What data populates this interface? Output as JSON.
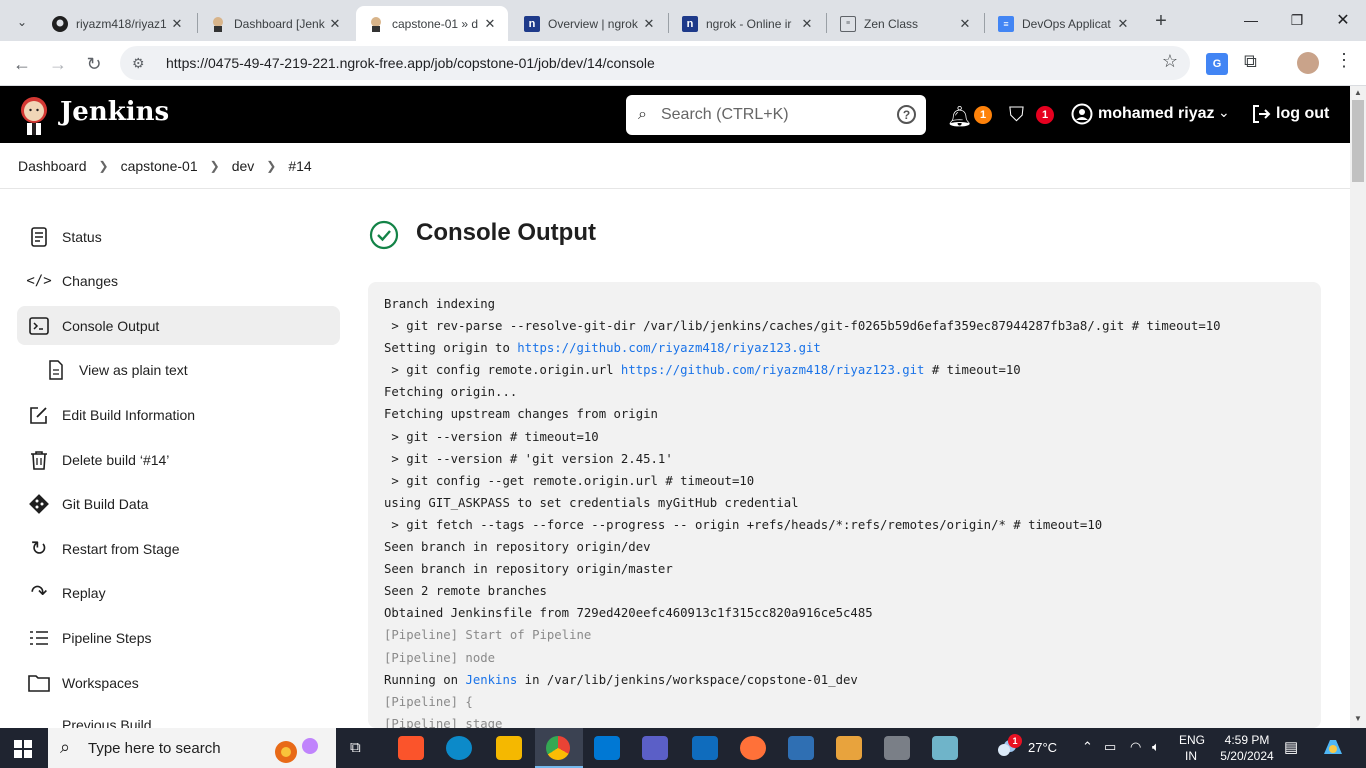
{
  "browser": {
    "tabs": [
      {
        "title": "riyazm418/riyaz1",
        "favicon": "github-icon"
      },
      {
        "title": "Dashboard [Jenk",
        "favicon": "jenkins-icon"
      },
      {
        "title": "capstone-01 » d",
        "favicon": "jenkins-icon"
      },
      {
        "title": "Overview | ngrok",
        "favicon": "ngrok-icon"
      },
      {
        "title": "ngrok - Online ir",
        "favicon": "ngrok-icon"
      },
      {
        "title": "Zen Class",
        "favicon": "zen-icon"
      },
      {
        "title": "DevOps Applicat",
        "favicon": "docs-icon"
      }
    ],
    "active_tab": 2,
    "url": "https://0475-49-47-219-221.ngrok-free.app/job/copstone-01/job/dev/14/console"
  },
  "jenkins": {
    "title": "Jenkins",
    "search_placeholder": "Search (CTRL+K)",
    "notifications_count": "1",
    "security_count": "1",
    "user": "mohamed riyaz",
    "logout": "log out",
    "breadcrumb": [
      "Dashboard",
      "capstone-01",
      "dev",
      "#14"
    ],
    "sidebar": [
      {
        "label": "Status",
        "icon": "document-icon"
      },
      {
        "label": "Changes",
        "icon": "code-icon"
      },
      {
        "label": "Console Output",
        "icon": "terminal-icon",
        "active": true
      },
      {
        "label": "View as plain text",
        "icon": "text-file-icon",
        "sub": true
      },
      {
        "label": "Edit Build Information",
        "icon": "edit-icon"
      },
      {
        "label": "Delete build ‘#14’",
        "icon": "trash-icon"
      },
      {
        "label": "Git Build Data",
        "icon": "git-icon"
      },
      {
        "label": "Restart from Stage",
        "icon": "restart-icon"
      },
      {
        "label": "Replay",
        "icon": "replay-icon"
      },
      {
        "label": "Pipeline Steps",
        "icon": "list-icon"
      },
      {
        "label": "Workspaces",
        "icon": "folder-icon"
      },
      {
        "label": "Previous Build",
        "icon": "arrow-left-icon"
      }
    ],
    "console_title": "Console Output",
    "console_lines": [
      {
        "text": "Branch indexing"
      },
      {
        "text": " > git rev-parse --resolve-git-dir /var/lib/jenkins/caches/git-f0265b59d6efaf359ec87944287fb3a8/.git # timeout=10"
      },
      {
        "pre": "Setting origin to ",
        "link": "https://github.com/riyazm418/riyaz123.git",
        "post": ""
      },
      {
        "pre": " > git config remote.origin.url ",
        "link": "https://github.com/riyazm418/riyaz123.git",
        "post": " # timeout=10"
      },
      {
        "text": "Fetching origin..."
      },
      {
        "text": "Fetching upstream changes from origin"
      },
      {
        "text": " > git --version # timeout=10"
      },
      {
        "text": " > git --version # 'git version 2.45.1'"
      },
      {
        "text": " > git config --get remote.origin.url # timeout=10"
      },
      {
        "text": "using GIT_ASKPASS to set credentials myGitHub credential"
      },
      {
        "text": " > git fetch --tags --force --progress -- origin +refs/heads/*:refs/remotes/origin/* # timeout=10"
      },
      {
        "text": "Seen branch in repository origin/dev"
      },
      {
        "text": "Seen branch in repository origin/master"
      },
      {
        "text": "Seen 2 remote branches"
      },
      {
        "text": "Obtained Jenkinsfile from 729ed420eefc460913c1f315cc820a916ce5c485"
      },
      {
        "text": "[Pipeline] Start of Pipeline",
        "muted": true
      },
      {
        "text": "[Pipeline] node",
        "muted": true
      },
      {
        "pre": "Running on ",
        "link": "Jenkins",
        "post": " in /var/lib/jenkins/workspace/copstone-01_dev"
      },
      {
        "text": "[Pipeline] {",
        "muted": true
      },
      {
        "text": "[Pipeline] stage",
        "muted": true
      }
    ]
  },
  "taskbar": {
    "search_placeholder": "Type here to search",
    "weather": "27°C",
    "lang": "ENG",
    "region": "IN",
    "time": "4:59 PM",
    "date": "5/20/2024",
    "weather_badge": "1"
  }
}
